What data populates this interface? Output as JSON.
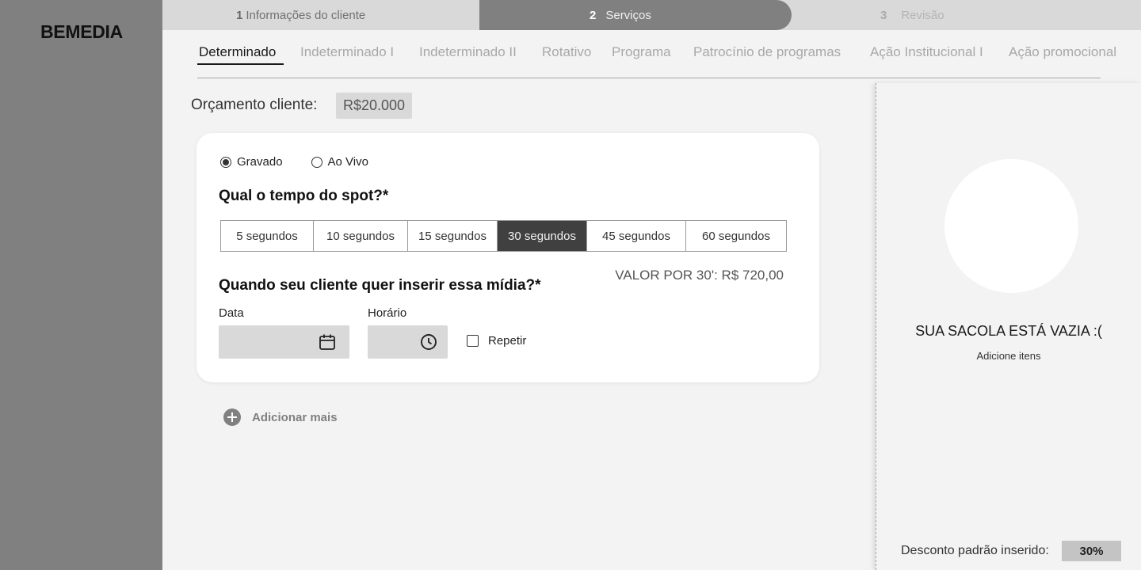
{
  "app": {
    "logo": "BEMEDIA"
  },
  "stepper": {
    "steps": [
      {
        "num": "1",
        "label": "Informações do cliente",
        "state": "done"
      },
      {
        "num": "2",
        "label": "Serviços",
        "state": "current"
      },
      {
        "num": "3",
        "label": "Revisão",
        "state": "pending"
      }
    ]
  },
  "tabs": [
    {
      "label": "Determinado",
      "active": true
    },
    {
      "label": "Indeterminado I"
    },
    {
      "label": "Indeterminado II"
    },
    {
      "label": "Rotativo"
    },
    {
      "label": "Programa"
    },
    {
      "label": "Patrocínio de programas"
    },
    {
      "label": "Ação Institucional I"
    },
    {
      "label": "Ação promocional"
    }
  ],
  "budget": {
    "label": "Orçamento cliente:",
    "value": "R$20.000"
  },
  "form": {
    "radios": [
      {
        "label": "Gravado",
        "checked": true
      },
      {
        "label": "Ao Vivo",
        "checked": false
      }
    ],
    "spot_question": "Qual o tempo do spot?*",
    "durations": [
      {
        "label": "5 segundos"
      },
      {
        "label": "10 segundos"
      },
      {
        "label": "15 segundos"
      },
      {
        "label": "30 segundos",
        "selected": true
      },
      {
        "label": "45 segundos"
      },
      {
        "label": "60 segundos"
      }
    ],
    "price_text": "VALOR POR 30': R$ 720,00",
    "when_question": "Quando seu cliente quer inserir essa mídia?*",
    "date_label": "Data",
    "time_label": "Horário",
    "repeat_label": "Repetir",
    "icons": {
      "date": "calendar-icon",
      "time": "clock-icon"
    }
  },
  "add_more": {
    "label": "Adicionar mais",
    "icon": "plus-circle-icon"
  },
  "bag": {
    "title": "SUA SACOLA ESTÁ VAZIA :(",
    "subtitle": "Adicione itens",
    "discount_label": "Desconto padrão inserido:",
    "discount_value": "30%"
  },
  "colors": {
    "sidebar": "#808080",
    "stepper_bg": "#d9d9d9",
    "stepper_active": "#808080",
    "page_bg": "#f3f3f3",
    "selected_segment": "#404040"
  }
}
